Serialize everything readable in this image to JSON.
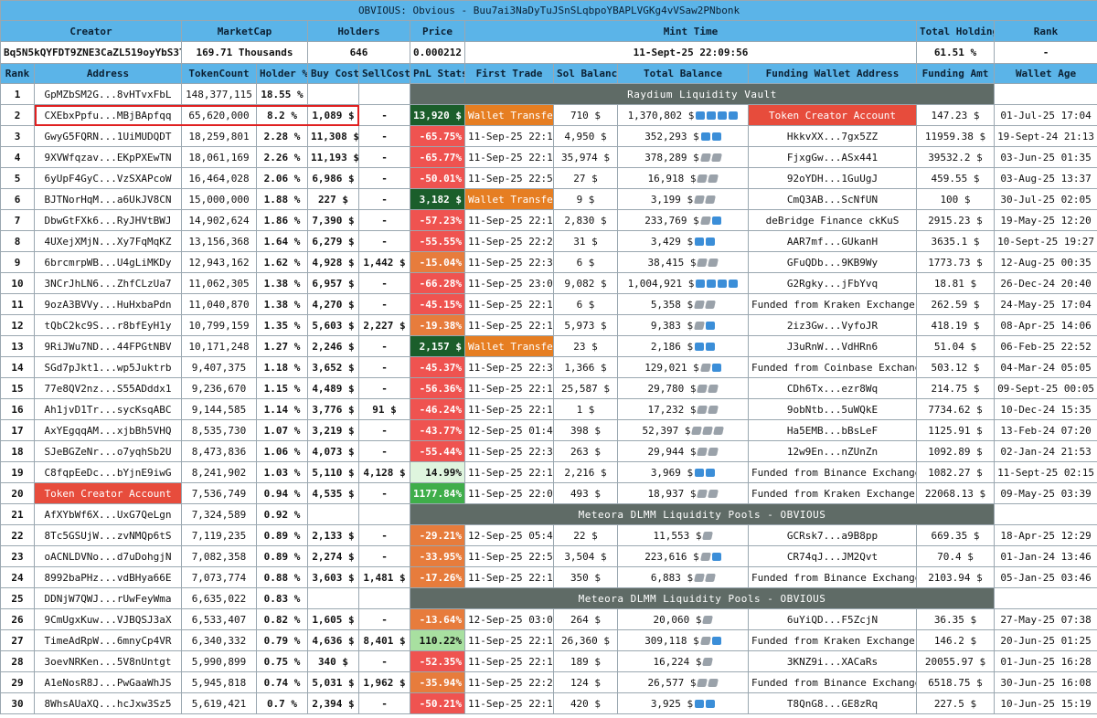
{
  "title": "OBVIOUS: Obvious - Buu7ai3NaDyTuJSnSLqbpoYBAPLVGKg4vVSaw2PNbonk",
  "summary_headers": [
    "Creator",
    "MarketCap",
    "Holders",
    "Price",
    "Mint Time",
    "Total Holding",
    "Rank"
  ],
  "summary": {
    "creator": "Bq5N5kQYFDT9ZNE3CaZL519oyYbS3TokSspouzqJvKjR",
    "marketcap": "169.71 Thousands",
    "holders": "646",
    "price": "0.000212",
    "mint_time": "11-Sept-25 22:09:56",
    "total_holding": "61.51 %",
    "rank": "-"
  },
  "columns": [
    "Rank",
    "Address",
    "TokenCount",
    "Holder %",
    "Buy Cost",
    "SellCost",
    "PnL Stats",
    "First Trade",
    "Sol Balance",
    "Total Balance",
    "Funding Wallet Address",
    "Funding Amt",
    "Wallet Age"
  ],
  "colors": {
    "header_bg": "#5bb4e8",
    "pnl_negative": "#ef5350",
    "pnl_negative_mild": "#e77c3c",
    "pnl_positive_dark": "#1b5e2b",
    "wallet_transfer": "#e67e22",
    "token_creator": "#e74c3c",
    "pool_banner": "#5f6b66",
    "highlight_box": "#e02020"
  },
  "rows": [
    {
      "rank": "1",
      "address": "GpMZbSM2G...8vHTvxFbL",
      "count": "148,377,115",
      "pct": "18.55 %",
      "banner": "Raydium Liquidity Vault",
      "banner_class": "vault"
    },
    {
      "rank": "2",
      "address": "CXEbxPpfu...MBjBApfqq",
      "count": "65,620,000",
      "pct": "8.2 %",
      "buy": "1,089 $",
      "sell": "-",
      "pnl": "13,920 $",
      "pnl_class": "pnl-pos-dark",
      "first": "Wallet Transfer",
      "first_class": "wallet-transfer",
      "sol": "710 $",
      "total": "1,370,802 $",
      "icons": [
        "blue",
        "blue",
        "blue",
        "blue"
      ],
      "fund": "Token Creator Account",
      "fund_class": "token-creator",
      "amt": "147.23 $",
      "age": "01-Jul-25 17:04",
      "highlight": true
    },
    {
      "rank": "3",
      "address": "GwyG5FQRN...1UiMUDQDT",
      "count": "18,259,801",
      "pct": "2.28 %",
      "buy": "11,308 $",
      "sell": "-",
      "pnl": "-65.75%",
      "pnl_class": "pnl-neg",
      "first": "11-Sep-25 22:11",
      "sol": "4,950 $",
      "total": "352,293 $",
      "icons": [
        "blue",
        "blue"
      ],
      "fund": "HkkvXX...7gx5ZZ",
      "amt": "11959.38 $",
      "age": "19-Sept-24 21:13"
    },
    {
      "rank": "4",
      "address": "9XVWfqzav...EKpPXEwTN",
      "count": "18,061,169",
      "pct": "2.26 %",
      "buy": "11,193 $",
      "sell": "-",
      "pnl": "-65.77%",
      "pnl_class": "pnl-neg",
      "first": "11-Sep-25 22:10",
      "sol": "35,974 $",
      "total": "378,289 $",
      "icons": [
        "gray",
        "gray"
      ],
      "fund": "FjxgGw...ASx441",
      "amt": "39532.2 $",
      "age": "03-Jun-25 01:35"
    },
    {
      "rank": "5",
      "address": "6yUpF4GyC...VzSXAPcoW",
      "count": "16,464,028",
      "pct": "2.06 %",
      "buy": "6,986 $",
      "sell": "-",
      "pnl": "-50.01%",
      "pnl_class": "pnl-neg",
      "first": "11-Sep-25 22:59",
      "sol": "27 $",
      "total": "16,918 $",
      "icons": [
        "gray",
        "gray"
      ],
      "fund": "92oYDH...1GuUgJ",
      "amt": "459.55 $",
      "age": "03-Aug-25 13:37"
    },
    {
      "rank": "6",
      "address": "BJTNorHqM...a6UkJV8CN",
      "count": "15,000,000",
      "pct": "1.88 %",
      "buy": "227 $",
      "sell": "-",
      "pnl": "3,182 $",
      "pnl_class": "pnl-pos-dark",
      "first": "Wallet Transfer",
      "first_class": "wallet-transfer",
      "sol": "9 $",
      "total": "3,199 $",
      "icons": [
        "gray",
        "gray"
      ],
      "fund": "CmQ3AB...ScNfUN",
      "amt": "100 $",
      "age": "30-Jul-25 02:05"
    },
    {
      "rank": "7",
      "address": "DbwGtFXk6...RyJHVtBWJ",
      "count": "14,902,624",
      "pct": "1.86 %",
      "buy": "7,390 $",
      "sell": "-",
      "pnl": "-57.23%",
      "pnl_class": "pnl-neg",
      "first": "11-Sep-25 22:12",
      "sol": "2,830 $",
      "total": "233,769 $",
      "icons": [
        "gray",
        "blue"
      ],
      "fund": "deBridge Finance ckKuS",
      "amt": "2915.23 $",
      "age": "19-May-25 12:20"
    },
    {
      "rank": "8",
      "address": "4UXejXMjN...Xy7FqMqKZ",
      "count": "13,156,368",
      "pct": "1.64 %",
      "buy": "6,279 $",
      "sell": "-",
      "pnl": "-55.55%",
      "pnl_class": "pnl-neg",
      "first": "11-Sep-25 22:20",
      "sol": "31 $",
      "total": "3,429 $",
      "icons": [
        "blue",
        "blue"
      ],
      "fund": "AAR7mf...GUkanH",
      "amt": "3635.1 $",
      "age": "10-Sept-25 19:27"
    },
    {
      "rank": "9",
      "address": "6brcmrpWB...U4gLiMKDy",
      "count": "12,943,162",
      "pct": "1.62 %",
      "buy": "4,928 $",
      "sell": "1,442 $",
      "pnl": "-15.04%",
      "pnl_class": "pnl-neg-light",
      "first": "11-Sep-25 22:36",
      "sol": "6 $",
      "total": "38,415 $",
      "icons": [
        "gray",
        "gray"
      ],
      "fund": "GFuQDb...9KB9Wy",
      "amt": "1773.73 $",
      "age": "12-Aug-25 00:35"
    },
    {
      "rank": "10",
      "address": "3NCrJhLN6...ZhfCLzUa7",
      "count": "11,062,305",
      "pct": "1.38 %",
      "buy": "6,957 $",
      "sell": "-",
      "pnl": "-66.28%",
      "pnl_class": "pnl-neg",
      "first": "11-Sep-25 23:07",
      "sol": "9,082 $",
      "total": "1,004,921 $",
      "icons": [
        "blue",
        "blue",
        "blue",
        "blue"
      ],
      "fund": "G2Rgky...jFbYvq",
      "amt": "18.81 $",
      "age": "26-Dec-24 20:40"
    },
    {
      "rank": "11",
      "address": "9ozA3BVVy...HuHxbaPdn",
      "count": "11,040,870",
      "pct": "1.38 %",
      "buy": "4,270 $",
      "sell": "-",
      "pnl": "-45.15%",
      "pnl_class": "pnl-neg",
      "first": "11-Sep-25 22:10",
      "sol": "6 $",
      "total": "5,358 $",
      "icons": [
        "gray",
        "gray"
      ],
      "fund": "Funded from Kraken Exchange",
      "amt": "262.59 $",
      "age": "24-May-25 17:04"
    },
    {
      "rank": "12",
      "address": "tQbC2kc9S...r8bfEyH1y",
      "count": "10,799,159",
      "pct": "1.35 %",
      "buy": "5,603 $",
      "sell": "2,227 $",
      "pnl": "-19.38%",
      "pnl_class": "pnl-neg-light",
      "first": "11-Sep-25 22:14",
      "sol": "5,973 $",
      "total": "9,383 $",
      "icons": [
        "gray",
        "blue"
      ],
      "fund": "2iz3Gw...VyfoJR",
      "amt": "418.19 $",
      "age": "08-Apr-25 14:06"
    },
    {
      "rank": "13",
      "address": "9RiJWu7ND...44FPGtNBV",
      "count": "10,171,248",
      "pct": "1.27 %",
      "buy": "2,246 $",
      "sell": "-",
      "pnl": "2,157 $",
      "pnl_class": "pnl-pos-dark",
      "first": "Wallet Transfer",
      "first_class": "wallet-transfer",
      "sol": "23 $",
      "total": "2,186 $",
      "icons": [
        "blue",
        "blue"
      ],
      "fund": "J3uRnW...VdHRn6",
      "amt": "51.04 $",
      "age": "06-Feb-25 22:52"
    },
    {
      "rank": "14",
      "address": "SGd7pJkt1...wp5Juktrb",
      "count": "9,407,375",
      "pct": "1.18 %",
      "buy": "3,652 $",
      "sell": "-",
      "pnl": "-45.37%",
      "pnl_class": "pnl-neg",
      "first": "11-Sep-25 22:36",
      "sol": "1,366 $",
      "total": "129,021 $",
      "icons": [
        "gray",
        "blue"
      ],
      "fund": "Funded from Coinbase Exchange",
      "amt": "503.12 $",
      "age": "04-Mar-24 05:05"
    },
    {
      "rank": "15",
      "address": "77e8QV2nz...S55ADddx1",
      "count": "9,236,670",
      "pct": "1.15 %",
      "buy": "4,489 $",
      "sell": "-",
      "pnl": "-56.36%",
      "pnl_class": "pnl-neg",
      "first": "11-Sep-25 22:10",
      "sol": "25,587 $",
      "total": "29,780 $",
      "icons": [
        "gray",
        "gray"
      ],
      "fund": "CDh6Tx...ezr8Wq",
      "amt": "214.75 $",
      "age": "09-Sept-25 00:05"
    },
    {
      "rank": "16",
      "address": "Ah1jvD1Tr...sycKsqABC",
      "count": "9,144,585",
      "pct": "1.14 %",
      "buy": "3,776 $",
      "sell": "91 $",
      "pnl": "-46.24%",
      "pnl_class": "pnl-neg",
      "first": "11-Sep-25 22:12",
      "sol": "1 $",
      "total": "17,232 $",
      "icons": [
        "gray",
        "gray"
      ],
      "fund": "9obNtb...5uWQkE",
      "amt": "7734.62 $",
      "age": "10-Dec-24 15:35"
    },
    {
      "rank": "17",
      "address": "AxYEgqqAM...xjbBh5VHQ",
      "count": "8,535,730",
      "pct": "1.07 %",
      "buy": "3,219 $",
      "sell": "-",
      "pnl": "-43.77%",
      "pnl_class": "pnl-neg",
      "first": "12-Sep-25 01:48",
      "sol": "398 $",
      "total": "52,397 $",
      "icons": [
        "gray",
        "gray",
        "gray"
      ],
      "fund": "Ha5EMB...bBsLeF",
      "amt": "1125.91 $",
      "age": "13-Feb-24 07:20"
    },
    {
      "rank": "18",
      "address": "SJeBGZeNr...o7yqhSb2U",
      "count": "8,473,836",
      "pct": "1.06 %",
      "buy": "4,073 $",
      "sell": "-",
      "pnl": "-55.44%",
      "pnl_class": "pnl-neg",
      "first": "11-Sep-25 22:33",
      "sol": "263 $",
      "total": "29,944 $",
      "icons": [
        "gray",
        "gray"
      ],
      "fund": "12w9En...nZUnZn",
      "amt": "1092.89 $",
      "age": "02-Jan-24 21:53"
    },
    {
      "rank": "19",
      "address": "C8fqpEeDc...bYjnE9iwG",
      "count": "8,241,902",
      "pct": "1.03 %",
      "buy": "5,110 $",
      "sell": "4,128 $",
      "pnl": "14.99%",
      "pnl_class": "pnl-pos-light",
      "first": "11-Sep-25 22:10",
      "sol": "2,216 $",
      "total": "3,969 $",
      "icons": [
        "blue",
        "blue"
      ],
      "fund": "Funded from Binance Exchange",
      "amt": "1082.27 $",
      "age": "11-Sept-25 02:15"
    },
    {
      "rank": "20",
      "address": "Token Creator Account",
      "address_class": "token-creator",
      "count": "7,536,749",
      "pct": "0.94 %",
      "buy": "4,535 $",
      "sell": "-",
      "pnl": "1177.84%",
      "pnl_class": "pnl-pos-mid",
      "first": "11-Sep-25 22:09",
      "sol": "493 $",
      "total": "18,937 $",
      "icons": [
        "gray",
        "gray"
      ],
      "fund": "Funded from Kraken Exchange",
      "amt": "22068.13 $",
      "age": "09-May-25 03:39"
    },
    {
      "rank": "21",
      "address": "AfXYbWf6X...UxG7QeLgn",
      "count": "7,324,589",
      "pct": "0.92 %",
      "banner": "Meteora DLMM Liquidity Pools - OBVIOUS",
      "banner_class": "vault"
    },
    {
      "rank": "22",
      "address": "8Tc5GSUjW...zvNMQp6tS",
      "count": "7,119,235",
      "pct": "0.89 %",
      "buy": "2,133 $",
      "sell": "-",
      "pnl": "-29.21%",
      "pnl_class": "pnl-neg-light",
      "first": "12-Sep-25 05:41",
      "sol": "22 $",
      "total": "11,553 $",
      "icons": [
        "gray"
      ],
      "fund": "GCRsk7...a9B8pp",
      "amt": "669.35 $",
      "age": "18-Apr-25 12:29"
    },
    {
      "rank": "23",
      "address": "oACNLDVNo...d7uDohgjN",
      "count": "7,082,358",
      "pct": "0.89 %",
      "buy": "2,274 $",
      "sell": "-",
      "pnl": "-33.95%",
      "pnl_class": "pnl-neg-light",
      "first": "11-Sep-25 22:55",
      "sol": "3,504 $",
      "total": "223,616 $",
      "icons": [
        "gray",
        "blue"
      ],
      "fund": "CR74qJ...JM2Qvt",
      "amt": "70.4 $",
      "age": "01-Jan-24 13:46"
    },
    {
      "rank": "24",
      "address": "8992baPHz...vdBHya66E",
      "count": "7,073,774",
      "pct": "0.88 %",
      "buy": "3,603 $",
      "sell": "1,481 $",
      "pnl": "-17.26%",
      "pnl_class": "pnl-neg-light",
      "first": "11-Sep-25 22:11",
      "sol": "350 $",
      "total": "6,883 $",
      "icons": [
        "gray",
        "gray"
      ],
      "fund": "Funded from Binance Exchange",
      "amt": "2103.94 $",
      "age": "05-Jan-25 03:46"
    },
    {
      "rank": "25",
      "address": "DDNjW7QWJ...rUwFeyWma",
      "count": "6,635,022",
      "pct": "0.83 %",
      "banner": "Meteora DLMM Liquidity Pools - OBVIOUS",
      "banner_class": "vault"
    },
    {
      "rank": "26",
      "address": "9CmUgxKuw...VJBQSJ3aX",
      "count": "6,533,407",
      "pct": "0.82 %",
      "buy": "1,605 $",
      "sell": "-",
      "pnl": "-13.64%",
      "pnl_class": "pnl-neg-light",
      "first": "12-Sep-25 03:07",
      "sol": "264 $",
      "total": "20,060 $",
      "icons": [
        "gray"
      ],
      "fund": "6uYiQD...F5ZcjN",
      "amt": "36.35 $",
      "age": "27-May-25 07:38"
    },
    {
      "rank": "27",
      "address": "TimeAdRpW...6mnyCp4VR",
      "count": "6,340,332",
      "pct": "0.79 %",
      "buy": "4,636 $",
      "sell": "8,401 $",
      "pnl": "110.22%",
      "pnl_class": "pnl-pos-pale",
      "first": "11-Sep-25 22:10",
      "sol": "26,360 $",
      "total": "309,118 $",
      "icons": [
        "gray",
        "blue"
      ],
      "fund": "Funded from Kraken Exchange",
      "amt": "146.2 $",
      "age": "20-Jun-25 01:25"
    },
    {
      "rank": "28",
      "address": "3oevNRKen...5V8nUntgt",
      "count": "5,990,899",
      "pct": "0.75 %",
      "buy": "340 $",
      "sell": "-",
      "pnl": "-52.35%",
      "pnl_class": "pnl-neg",
      "first": "11-Sep-25 22:16",
      "sol": "189 $",
      "total": "16,224 $",
      "icons": [
        "gray"
      ],
      "fund": "3KNZ9i...XACaRs",
      "amt": "20055.97 $",
      "age": "01-Jun-25 16:28"
    },
    {
      "rank": "29",
      "address": "A1eNosR8J...PwGaaWhJS",
      "count": "5,945,818",
      "pct": "0.74 %",
      "buy": "5,031 $",
      "sell": "1,962 $",
      "pnl": "-35.94%",
      "pnl_class": "pnl-neg-light",
      "first": "11-Sep-25 22:20",
      "sol": "124 $",
      "total": "26,577 $",
      "icons": [
        "gray",
        "gray"
      ],
      "fund": "Funded from Binance Exchange",
      "amt": "6518.75 $",
      "age": "30-Jun-25 16:08"
    },
    {
      "rank": "30",
      "address": "8WhsAUaXQ...hcJxw3Sz5",
      "count": "5,619,421",
      "pct": "0.7 %",
      "buy": "2,394 $",
      "sell": "-",
      "pnl": "-50.21%",
      "pnl_class": "pnl-neg",
      "first": "11-Sep-25 22:11",
      "sol": "420 $",
      "total": "3,925 $",
      "icons": [
        "blue",
        "blue"
      ],
      "fund": "T8QnG8...GE8zRq",
      "amt": "227.5 $",
      "age": "10-Jun-25 15:19"
    }
  ]
}
